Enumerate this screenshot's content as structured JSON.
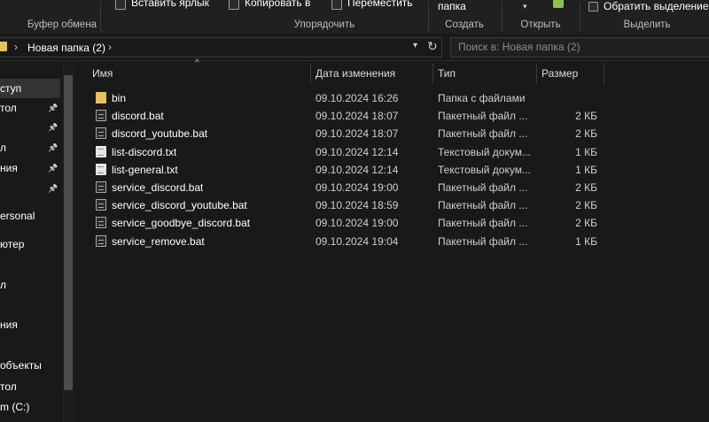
{
  "ribbon": {
    "paste_shortcut_label": "Вставить ярлык",
    "copy_to_label": "Копировать в",
    "move_to_label": "Переместить",
    "new_folder_label": "папка",
    "select_all_label": "Обратить выделение",
    "groups": {
      "clipboard": "Буфер обмена",
      "organize": "Упорядочить",
      "new": "Создать",
      "open": "Открыть",
      "select": "Выделить"
    }
  },
  "address": {
    "breadcrumb": "Новая папка (2)",
    "search_placeholder": "Поиск в: Новая папка (2)"
  },
  "nav": {
    "items": [
      {
        "label": "ступ",
        "pinned": false,
        "selected": true
      },
      {
        "label": "тол",
        "pinned": true
      },
      {
        "label": "",
        "pinned": true
      },
      {
        "label": "л",
        "pinned": true
      },
      {
        "label": "ния",
        "pinned": true
      },
      {
        "label": "",
        "pinned": true
      },
      {
        "label": "ersonal",
        "pinned": false
      },
      {
        "label": "ютер",
        "pinned": false
      },
      {
        "label": "",
        "pinned": false
      },
      {
        "label": "л",
        "pinned": false
      },
      {
        "label": "",
        "pinned": false
      },
      {
        "label": "ния",
        "pinned": false
      },
      {
        "label": "",
        "pinned": false
      },
      {
        "label": "объекты",
        "pinned": false
      },
      {
        "label": "тол",
        "pinned": false
      },
      {
        "label": "m (C:)",
        "pinned": false
      }
    ]
  },
  "columns": {
    "name": "Имя",
    "date": "Дата изменения",
    "type": "Тип",
    "size": "Размер"
  },
  "files": [
    {
      "name": "bin",
      "date": "09.10.2024 16:26",
      "type": "Папка с файлами",
      "size": "",
      "icon": "folder-icon"
    },
    {
      "name": "discord.bat",
      "date": "09.10.2024 18:07",
      "type": "Пакетный файл ...",
      "size": "2 КБ",
      "icon": "batch-file-icon"
    },
    {
      "name": "discord_youtube.bat",
      "date": "09.10.2024 18:07",
      "type": "Пакетный файл ...",
      "size": "2 КБ",
      "icon": "batch-file-icon"
    },
    {
      "name": "list-discord.txt",
      "date": "09.10.2024 12:14",
      "type": "Текстовый докум...",
      "size": "1 КБ",
      "icon": "text-file-icon"
    },
    {
      "name": "list-general.txt",
      "date": "09.10.2024 12:14",
      "type": "Текстовый докум...",
      "size": "1 КБ",
      "icon": "text-file-icon"
    },
    {
      "name": "service_discord.bat",
      "date": "09.10.2024 19:00",
      "type": "Пакетный файл ...",
      "size": "2 КБ",
      "icon": "batch-file-icon"
    },
    {
      "name": "service_discord_youtube.bat",
      "date": "09.10.2024 18:59",
      "type": "Пакетный файл ...",
      "size": "2 КБ",
      "icon": "batch-file-icon"
    },
    {
      "name": "service_goodbye_discord.bat",
      "date": "09.10.2024 19:00",
      "type": "Пакетный файл ...",
      "size": "2 КБ",
      "icon": "batch-file-icon"
    },
    {
      "name": "service_remove.bat",
      "date": "09.10.2024 19:04",
      "type": "Пакетный файл ...",
      "size": "1 КБ",
      "icon": "batch-file-icon"
    }
  ],
  "colors": {
    "background": "#191919",
    "ribbon": "#202020",
    "folder": "#e8c25c",
    "selection": "#333333"
  }
}
